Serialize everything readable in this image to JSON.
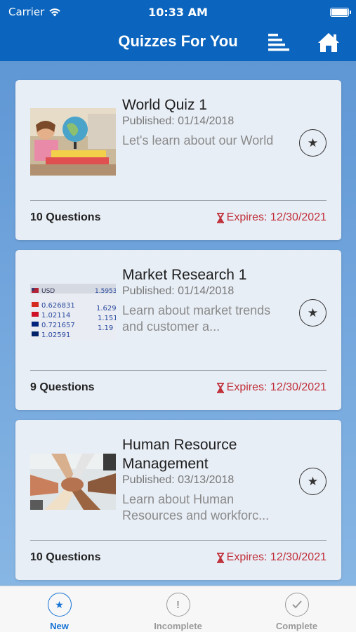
{
  "status_bar": {
    "carrier": "Carrier",
    "time": "10:33 AM"
  },
  "nav": {
    "title": "Quizzes For You"
  },
  "quizzes": [
    {
      "title": "World Quiz 1",
      "published": "Published: 01/14/2018",
      "description": "Let's learn about our World",
      "questions": "10 Questions",
      "expires": "Expires: 12/30/2021"
    },
    {
      "title": "Market Research 1",
      "published": "Published: 01/14/2018",
      "description": "Learn about market trends and customer a...",
      "questions": "9 Questions",
      "expires": "Expires: 12/30/2021"
    },
    {
      "title": "Human Resource Management",
      "published": "Published: 03/13/2018",
      "description": "Learn about Human Resources and workforc...",
      "questions": "10 Questions",
      "expires": "Expires: 12/30/2021"
    }
  ],
  "tabs": [
    {
      "label": "New",
      "icon": "star-icon"
    },
    {
      "label": "Incomplete",
      "icon": "exclamation-icon"
    },
    {
      "label": "Complete",
      "icon": "check-icon"
    }
  ],
  "colors": {
    "nav": "#0b64bd",
    "accent": "#1673d4",
    "expires": "#c0303a"
  }
}
